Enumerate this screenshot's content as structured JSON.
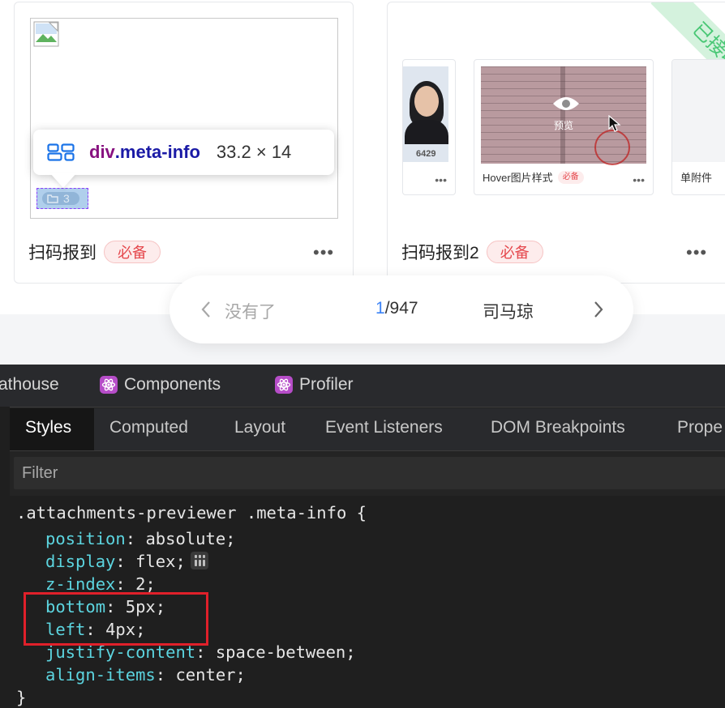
{
  "cards": [
    {
      "title": "扫码报到",
      "badge": "必备",
      "meta_count": "3",
      "tooltip": {
        "tag": "div",
        "class": ".meta-info",
        "size": "33.2 × 14"
      }
    },
    {
      "title": "扫码报到2",
      "badge": "必备",
      "ribbon": "已接收",
      "attachments": [
        {
          "number": "6429"
        },
        {
          "label": "Hover图片样式",
          "badge": "必备",
          "overlay": "预览"
        },
        {
          "label": "单附件"
        }
      ]
    }
  ],
  "pager": {
    "prev_label": "没有了",
    "current": "1",
    "total": "/947",
    "next_label": "司马琼"
  },
  "devtools": {
    "top_tabs": [
      "athouse",
      "Components",
      "Profiler"
    ],
    "sub_tabs": [
      "Styles",
      "Computed",
      "Layout",
      "Event Listeners",
      "DOM Breakpoints",
      "Prope"
    ],
    "filter_placeholder": "Filter",
    "selector": ".attachments-previewer .meta-info {",
    "declarations": [
      {
        "prop": "position",
        "value": "absolute;"
      },
      {
        "prop": "display",
        "value": "flex;"
      },
      {
        "prop": "z-index",
        "value": "2;"
      },
      {
        "prop": "bottom",
        "value": "5px;"
      },
      {
        "prop": "left",
        "value": "4px;"
      },
      {
        "prop": "justify-content",
        "value": "space-between;"
      },
      {
        "prop": "align-items",
        "value": "center;"
      }
    ],
    "closing": "}"
  },
  "colors": {
    "accent": "#3b82f6",
    "badge_text": "#e5484d",
    "ribbon": "#48c774",
    "highlight_box": "#e0202a"
  }
}
